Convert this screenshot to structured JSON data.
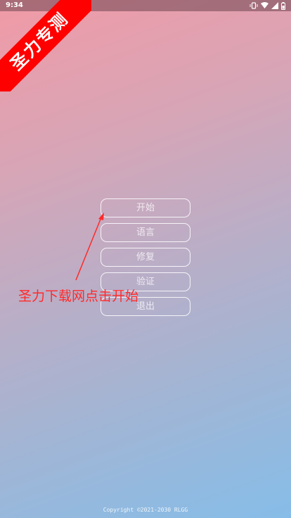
{
  "status_bar": {
    "time": "9:34",
    "icons": [
      "vibrate-icon",
      "wifi-icon",
      "signal-icon",
      "battery-icon"
    ]
  },
  "ribbon": {
    "text": "圣力专测",
    "color": "#ff0000"
  },
  "menu": {
    "items": [
      {
        "label": "开始"
      },
      {
        "label": "语言"
      },
      {
        "label": "修复"
      },
      {
        "label": "验证"
      },
      {
        "label": "退出"
      }
    ]
  },
  "annotation": {
    "text": "圣力下载网点击开始",
    "color": "#ff2a2a"
  },
  "footer": {
    "copyright": "Copyright ©2021-2030 RLGG"
  }
}
